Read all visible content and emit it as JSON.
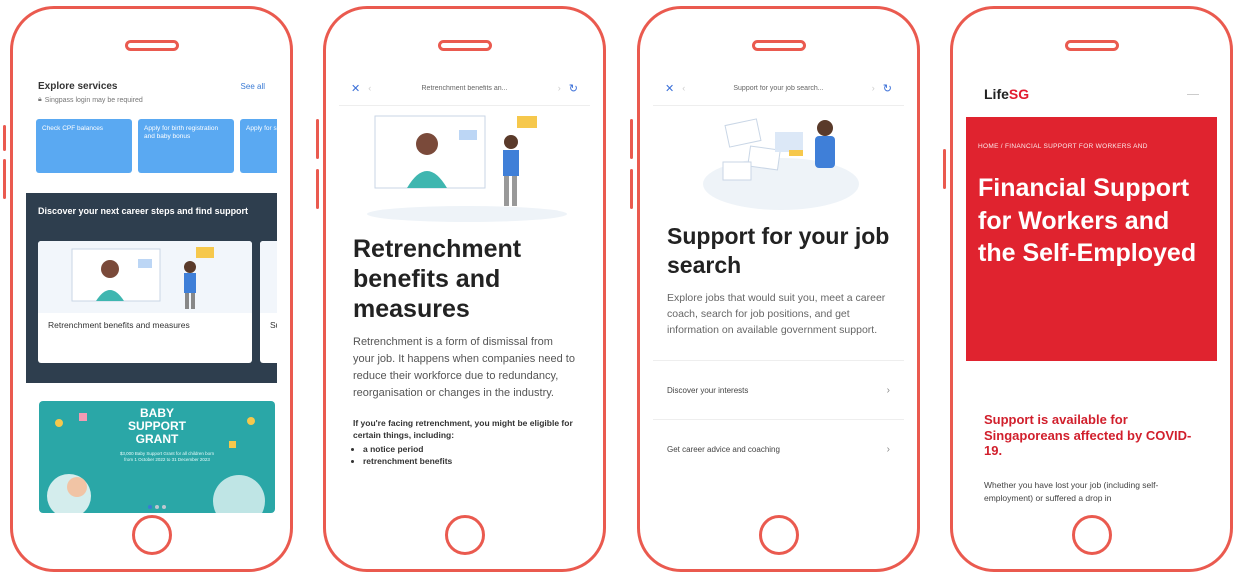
{
  "phone1": {
    "explore_title": "Explore services",
    "see_all": "See all",
    "note": "Singpass login may be required",
    "tiles": [
      "Check CPF balances",
      "Apply for birth registration and baby bonus",
      "Apply for services"
    ],
    "section_title": "Discover your next career steps and find support",
    "cards": [
      "Retrenchment benefits and measures",
      "Sup"
    ],
    "banner_title": "BABY SUPPORT GRANT",
    "banner_sub": "$3,000 Baby Support Grant for all children born from 1 October 2022 to 31 December 2023"
  },
  "phone2": {
    "bar_title": "Retrenchment benefits an...",
    "title": "Retrenchment benefits and measures",
    "body": "Retrenchment is a form of dismissal from your job. It happens when companies need to reduce their workforce due to redundancy, reorganisation or changes in the industry.",
    "bold": "If you're facing retrenchment, you might be eligible for certain things, including:",
    "list": [
      "a notice period",
      "retrenchment benefits"
    ]
  },
  "phone3": {
    "bar_title": "Support for your job search...",
    "title": "Support for your job search",
    "body": "Explore jobs that would suit you, meet a career coach, search for job positions, and get information on available government support.",
    "links": [
      "Discover your interests",
      "Get career advice and coaching"
    ]
  },
  "phone4": {
    "logo_a": "Life",
    "logo_b": "SG",
    "crumb": "HOME   /   FINANCIAL SUPPORT FOR WORKERS AND",
    "title": "Financial Support for Workers and the Self-Employed",
    "sub": "Support is available for Singaporeans affected by COVID-19.",
    "body": "Whether you have lost your job (including self-employment) or suffered a drop in"
  },
  "colors": {
    "frame": "#ea5a4f",
    "brand_red": "#e0232f",
    "link_blue": "#3a6fd8",
    "tile_blue": "#5aa9f2"
  }
}
